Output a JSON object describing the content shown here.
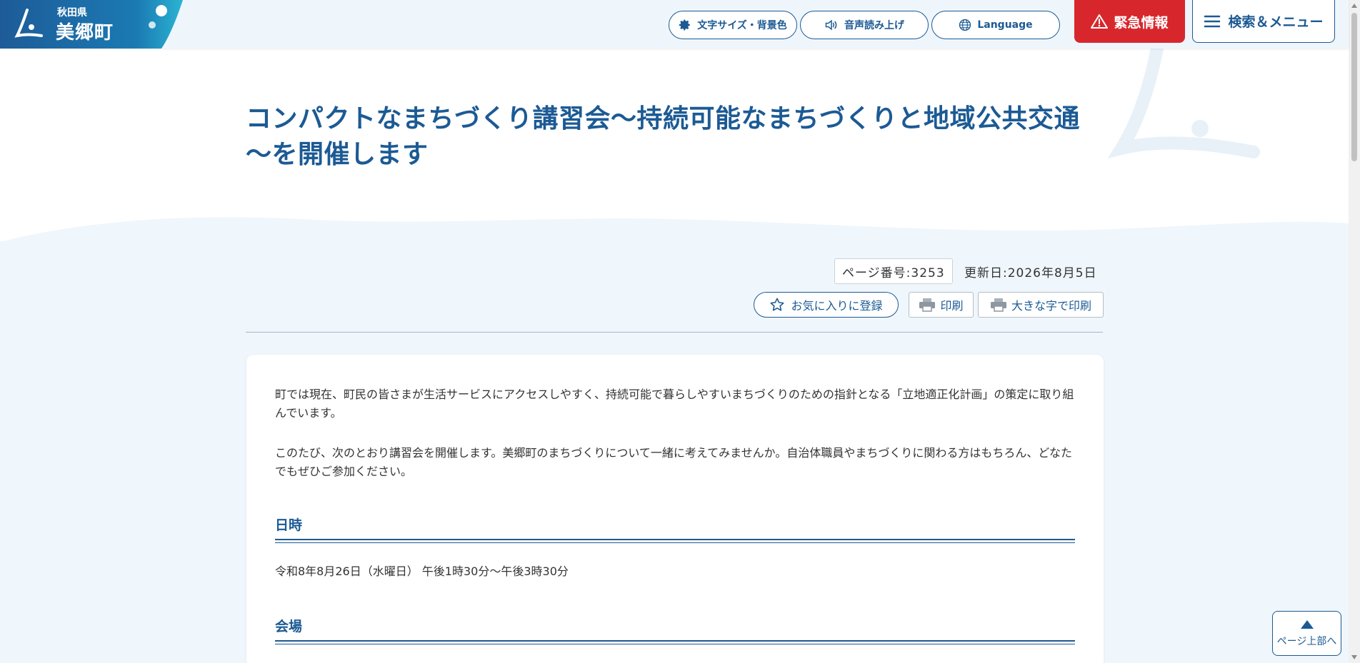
{
  "header": {
    "logo_pref": "秋田県",
    "logo_town": "美郷町",
    "font_size_label": "文字サイズ・背景色",
    "audio_label": "音声読み上げ",
    "language_label": "Language",
    "emergency_label": "緊急情報",
    "menu_label": "検索＆メニュー"
  },
  "title": "コンパクトなまちづくり講習会～持続可能なまちづくりと地域公共交通～を開催します",
  "meta": {
    "page_number": "ページ番号:3253",
    "updated": "更新日:2026年8月5日",
    "favorite_label": "お気に入りに登録",
    "print_label": "印刷",
    "large_print_label": "大きな字で印刷"
  },
  "content": {
    "para1": "町では現在、町民の皆さまが生活サービスにアクセスしやすく、持続可能で暮らしやすいまちづくりのための指針となる「立地適正化計画」の策定に取り組んでいます。",
    "para2": "このたび、次のとおり講習会を開催します。美郷町のまちづくりについて一緒に考えてみませんか。自治体職員やまちづくりに関わる方はもちろん、どなたでもぜひご参加ください。",
    "heading_datetime": "日時",
    "datetime": "令和8年8月26日（水曜日） 午後1時30分～午後3時30分",
    "heading_venue": "会場"
  },
  "pagetop_label": "ページ上部へ",
  "colors": {
    "brand_blue": "#1c5a94",
    "emergency_red": "#d8272c",
    "header_bg": "#eef6fc",
    "lower_bg": "#eff6fc"
  },
  "icons": {
    "font_size": "gear-icon",
    "audio": "speaker-icon",
    "language": "globe-icon",
    "emergency": "warning-icon",
    "menu": "hamburger-icon",
    "favorite": "star-icon",
    "print": "printer-icon",
    "pagetop": "triangle-up-icon"
  }
}
